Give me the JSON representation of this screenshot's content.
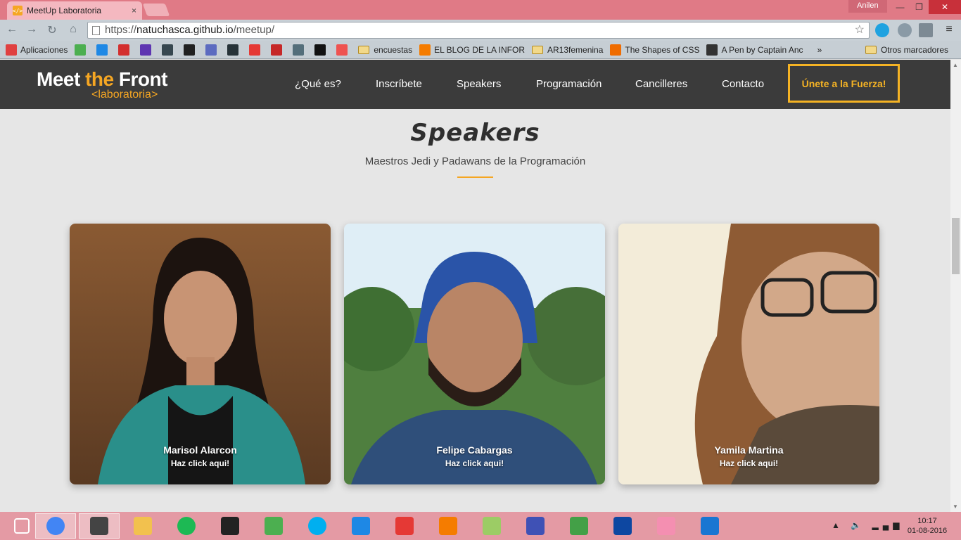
{
  "browser": {
    "tab_title": "MeetUp Laboratoria",
    "tab_close": "×",
    "user": "Anilen",
    "url_prefix": "https://",
    "url_host": "natuchasca.github.io",
    "url_path": "/meetup/",
    "bookmarks": [
      {
        "label": "Aplicaciones",
        "icon": "apps-grid-icon",
        "color": "#e04040"
      },
      {
        "label": "",
        "icon": "w3-icon",
        "color": "#4caf50"
      },
      {
        "label": "",
        "icon": "bookmark-icon",
        "color": "#1e88e5"
      },
      {
        "label": "",
        "icon": "book-icon",
        "color": "#d32f2f"
      },
      {
        "label": "",
        "icon": "list-icon",
        "color": "#5e35b1"
      },
      {
        "label": "",
        "icon": "code-icon",
        "color": "#37474f"
      },
      {
        "label": "",
        "icon": "r-icon",
        "color": "#212121"
      },
      {
        "label": "",
        "icon": "b-icon",
        "color": "#5c6bc0"
      },
      {
        "label": "",
        "icon": "fm-icon",
        "color": "#263238"
      },
      {
        "label": "",
        "icon": "gmail-icon",
        "color": "#e53935"
      },
      {
        "label": "",
        "icon": "help-icon",
        "color": "#c62828"
      },
      {
        "label": "",
        "icon": "doc-icon",
        "color": "#546e7a"
      },
      {
        "label": "",
        "icon": "github-icon",
        "color": "#111111"
      },
      {
        "label": "",
        "icon": "wave-icon",
        "color": "#ef5350"
      },
      {
        "label": "encuestas",
        "icon": "folder-icon",
        "color": "#f2d98a"
      },
      {
        "label": "EL BLOG DE LA INFOR",
        "icon": "blogger-icon",
        "color": "#f57c00"
      },
      {
        "label": "AR13femenina",
        "icon": "folder-icon",
        "color": "#f2d98a"
      },
      {
        "label": "The Shapes of CSS",
        "icon": "asterisk-icon",
        "color": "#ef6c00"
      },
      {
        "label": "A Pen by Captain Anc",
        "icon": "codepen-icon",
        "color": "#333333"
      }
    ],
    "more_bookmarks": "»",
    "other_bookmarks": "Otros marcadores"
  },
  "site": {
    "logo_main": "Meet ",
    "logo_the": "the",
    "logo_front": " Front",
    "logo_sub": "<laboratoria>",
    "nav": [
      "¿Qué es?",
      "Inscríbete",
      "Speakers",
      "Programación",
      "Cancilleres",
      "Contacto"
    ],
    "cta": "Únete a la Fuerza!",
    "section_title": "Speakers",
    "section_subtitle": "Maestros Jedi y Padawans de la Programación",
    "speakers": [
      {
        "name": "Marisol Alarcon",
        "link": "Haz click aqui!"
      },
      {
        "name": "Felipe Cabargas",
        "link": "Haz click aqui!"
      },
      {
        "name": "Yamila Martina",
        "link": "Haz click aqui!"
      }
    ]
  },
  "taskbar": {
    "time": "10:17",
    "date": "01-08-2016",
    "apps": [
      "windows-start-icon",
      "chrome-icon",
      "sublime-text-icon",
      "file-explorer-icon",
      "spotify-icon",
      "terminal-icon",
      "google-drive-icon",
      "skype-icon",
      "screenshot-icon",
      "popcorn-time-icon",
      "blender-icon",
      "sticky-notes-icon",
      "gamepad-icon",
      "android-studio-icon",
      "photoshop-icon",
      "paint-icon",
      "photo-viewer-icon"
    ]
  },
  "colors": {
    "accent": "#f5a623",
    "header_bg": "#3b3b3b",
    "page_bg": "#e6e6e6"
  }
}
